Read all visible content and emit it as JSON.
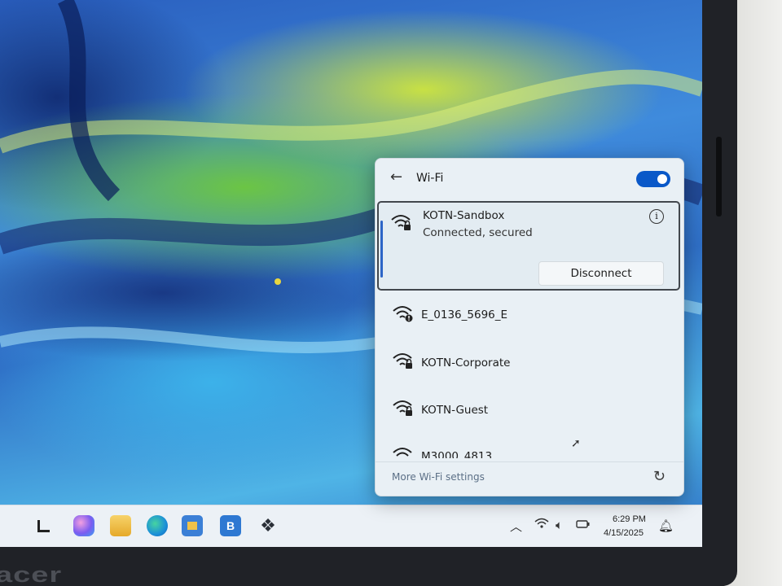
{
  "wifi_panel": {
    "title": "Wi-Fi",
    "toggle_state": "on",
    "connected_network": {
      "ssid": "KOTN-Sandbox",
      "status": "Connected, secured",
      "disconnect_label": "Disconnect"
    },
    "networks": [
      {
        "ssid": "E_0136_5696_E",
        "icon": "wifi-warning-icon"
      },
      {
        "ssid": "KOTN-Corporate",
        "icon": "wifi-secured-icon"
      },
      {
        "ssid": "KOTN-Guest",
        "icon": "wifi-secured-icon"
      },
      {
        "ssid": "M3000_4813",
        "icon": "wifi-icon"
      }
    ],
    "more_settings_label": "More Wi-Fi settings"
  },
  "taskbar": {
    "icons": [
      "start-icon",
      "copilot-icon",
      "file-explorer-icon",
      "edge-icon",
      "store-icon",
      "b-app-icon",
      "dropbox-icon"
    ],
    "app_b_label": "B",
    "tray": {
      "time": "6:29 PM",
      "date": "4/15/2025"
    }
  },
  "device": {
    "brand": "acer"
  },
  "colors": {
    "accent": "#0a58c8",
    "panel_bg": "#e9f0f5"
  }
}
